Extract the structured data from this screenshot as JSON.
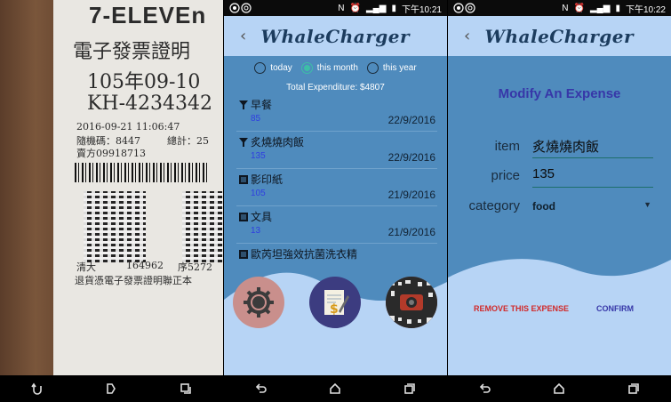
{
  "status_bar": {
    "screen2_time": "下午10:21",
    "screen3_time": "下午10:22"
  },
  "app": {
    "title": "WhaleCharger"
  },
  "receipt_photo": {
    "store": "7-ELEVEn",
    "line1": "電子發票證明",
    "line2": "105年09-10",
    "line3": "KH-4234342",
    "line4": "2016-09-21 11:06:47",
    "line5a": "隨機碼：8447",
    "line5b": "總計：25",
    "line6": "賣方09918713",
    "line7a": "清大",
    "line7b": "164962",
    "line7c": "序5272",
    "line8": "退貨憑電子發票證明聯正本"
  },
  "expense_list": {
    "filters": [
      {
        "label": "today",
        "selected": false
      },
      {
        "label": "this month",
        "selected": true
      },
      {
        "label": "this year",
        "selected": false
      }
    ],
    "total_label": "Total Expenditure: $4807",
    "items": [
      {
        "name": "早餐",
        "amount": "85",
        "date": "22/9/2016",
        "icon": "food-icon"
      },
      {
        "name": "炙燒燒肉飯",
        "amount": "135",
        "date": "22/9/2016",
        "icon": "food-icon"
      },
      {
        "name": "影印紙",
        "amount": "105",
        "date": "21/9/2016",
        "icon": "list-icon"
      },
      {
        "name": "文具",
        "amount": "13",
        "date": "21/9/2016",
        "icon": "list-icon"
      },
      {
        "name": "歐芮坦強效抗菌洗衣精",
        "amount": "",
        "date": "",
        "icon": "list-icon"
      }
    ],
    "buttons": [
      "settings-button",
      "add-expense-button",
      "scan-receipt-button"
    ]
  },
  "modify_expense": {
    "title": "Modify An Expense",
    "item_label": "item",
    "item_value": "炙燒燒肉飯",
    "price_label": "price",
    "price_value": "135",
    "category_label": "category",
    "category_value": "food",
    "remove_label": "REMOVE THIS EXPENSE",
    "confirm_label": "CONFIRM"
  },
  "colors": {
    "appbar": "#b7d4f5",
    "content": "#4f8bbd",
    "wave": "#b7d4f5",
    "remove": "#d12a2a",
    "confirm": "#3737a8"
  }
}
